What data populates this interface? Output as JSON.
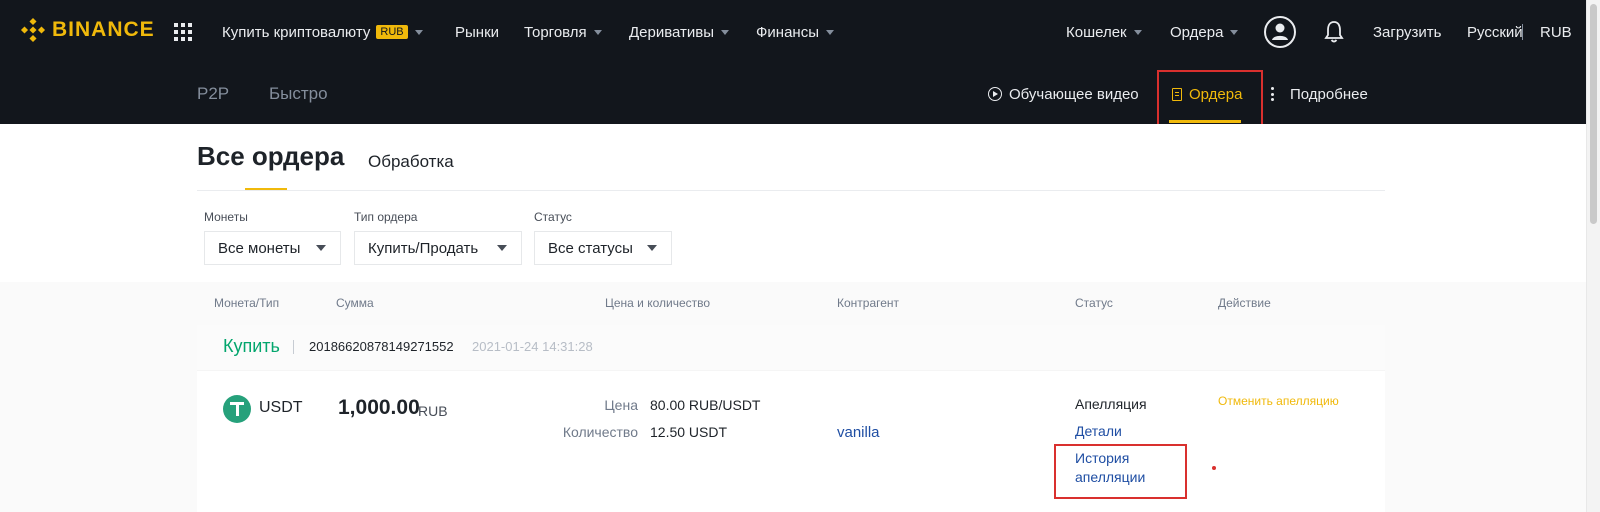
{
  "header": {
    "logo_text": "BINANCE",
    "nav": {
      "buy_crypto": "Купить криптовалюту",
      "buy_crypto_badge": "RUB",
      "markets": "Рынки",
      "trade": "Торговля",
      "derivatives": "Деривативы",
      "finance": "Финансы",
      "wallet": "Кошелек",
      "orders": "Ордера",
      "download": "Загрузить",
      "language": "Русский",
      "currency": "RUB"
    },
    "icons": [
      "apps-icon",
      "user-icon",
      "bell-icon"
    ]
  },
  "subnav": {
    "p2p": "P2P",
    "express": "Быстро",
    "tutorial": "Обучающее видео",
    "orders": "Ордера",
    "more": "Подробнее"
  },
  "page": {
    "title": "Все ордера",
    "tab_processing": "Обработка"
  },
  "filters": {
    "coins": {
      "label": "Монеты",
      "value": "Все монеты"
    },
    "order_type": {
      "label": "Тип ордера",
      "value": "Купить/Продать"
    },
    "status": {
      "label": "Статус",
      "value": "Все статусы"
    }
  },
  "table": {
    "headers": [
      "Монета/Тип",
      "Сумма",
      "Цена и количество",
      "Контрагент",
      "Статус",
      "Действие"
    ]
  },
  "order": {
    "side": "Купить",
    "id": "20186620878149271552",
    "time": "2021-01-24 14:31:28",
    "coin": "USDT",
    "amount": "1,000.00",
    "amount_currency": "RUB",
    "price_label": "Цена",
    "price_value": "80.00 RUB/USDT",
    "qty_label": "Количество",
    "qty_value": "12.50 USDT",
    "counterparty": "vanilla",
    "status": "Апелляция",
    "details_link": "Детали",
    "appeal_history_line1": "История",
    "appeal_history_line2": "апелляции",
    "action": "Отменить апелляцию"
  },
  "colors": {
    "accent": "#f0b90b",
    "buy": "#03a66d",
    "link": "#1f4ea3",
    "highlight": "#d9302e",
    "header_bg": "#12161c"
  }
}
